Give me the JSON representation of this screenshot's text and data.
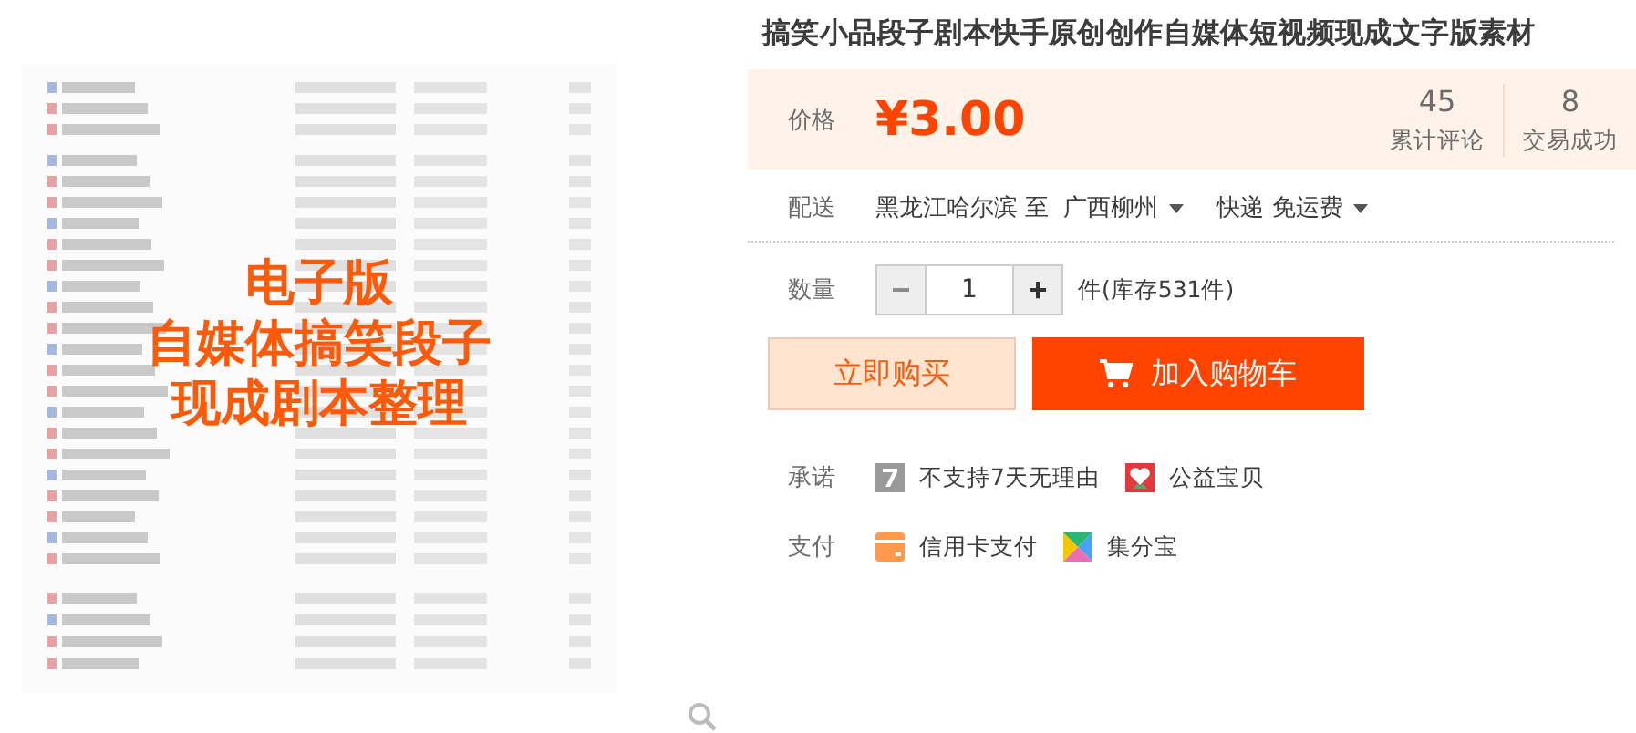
{
  "product_image": {
    "kind": "picture",
    "overlay_lines": [
      "电子版",
      "自媒体搞笑段子",
      "现成剧本整理"
    ]
  },
  "title": "搞笑小品段子剧本快手原创创作自媒体短视频现成文字版素材",
  "price": {
    "label": "价格",
    "value": "¥3.00"
  },
  "stats": [
    {
      "value": "45",
      "label": "累计评论"
    },
    {
      "value": "8",
      "label": "交易成功"
    }
  ],
  "delivery": {
    "label": "配送",
    "from": "黑龙江哈尔滨 至",
    "to": "广西柳州",
    "shipping": "快递 免运费"
  },
  "quantity": {
    "label": "数量",
    "minus": "−",
    "value": "1",
    "plus": "+",
    "stock": "件(库存531件)"
  },
  "buttons": [
    {
      "kind": "buy",
      "label": "立即购买"
    },
    {
      "kind": "cart",
      "label": "加入购物车"
    }
  ],
  "services": [
    {
      "label": "承诺",
      "items": [
        {
          "kind": "seven",
          "text": "不支持7天无理由"
        },
        {
          "kind": "charity",
          "text": "公益宝贝"
        }
      ]
    },
    {
      "label": "支付",
      "items": [
        {
          "kind": "card",
          "text": "信用卡支付"
        },
        {
          "kind": "jifen",
          "text": "集分宝"
        }
      ]
    }
  ]
}
